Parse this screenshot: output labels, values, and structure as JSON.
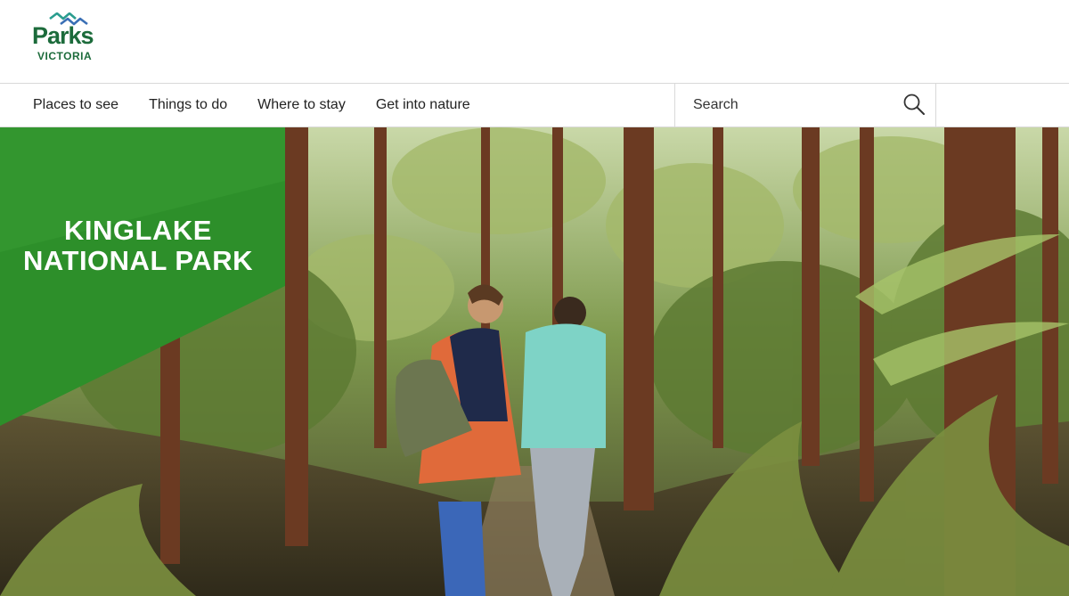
{
  "brand": {
    "name": "Parks",
    "subname": "VICTORIA",
    "colors": {
      "primary": "#1c6b3b",
      "wave_teal": "#2a9d8f",
      "wave_blue": "#3a6fb5",
      "banner_green": "#2d8f2a"
    }
  },
  "nav": {
    "items": [
      {
        "label": "Places to see"
      },
      {
        "label": "Things to do"
      },
      {
        "label": "Where to stay"
      },
      {
        "label": "Get into nature"
      }
    ]
  },
  "search": {
    "placeholder": "Search",
    "icon": "search-icon"
  },
  "hero": {
    "title_line1": "KINGLAKE",
    "title_line2": "NATIONAL PARK"
  }
}
